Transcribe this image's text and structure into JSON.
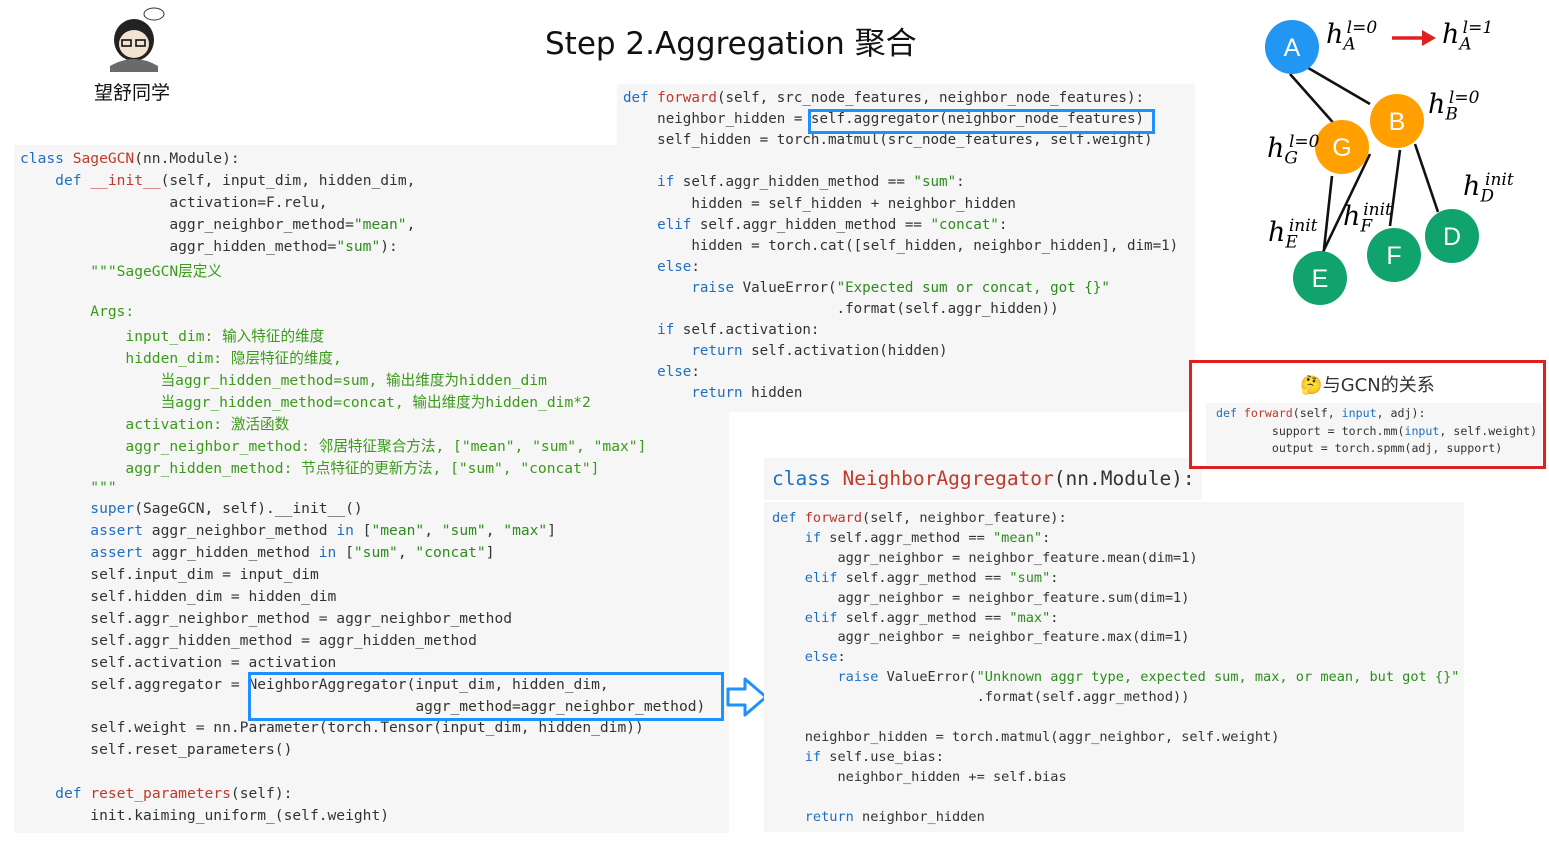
{
  "header": {
    "title": "Step 2.Aggregation  聚合",
    "brand": "望舒同学"
  },
  "sagegcn_code": [
    [
      [
        "kw",
        "class "
      ],
      [
        "fn",
        "SageGCN"
      ],
      [
        "",
        "(nn.Module):"
      ]
    ],
    [
      [
        "",
        "    "
      ],
      [
        "kw",
        "def "
      ],
      [
        "fn",
        "__init__"
      ],
      [
        "",
        "(self, input_dim, hidden_dim,"
      ]
    ],
    [
      [
        "",
        "                 activation=F.relu,"
      ]
    ],
    [
      [
        "",
        "                 aggr_neighbor_method="
      ],
      [
        "str",
        "\"mean\""
      ],
      [
        "",
        ","
      ]
    ],
    [
      [
        "",
        "                 aggr_hidden_method="
      ],
      [
        "str",
        "\"sum\""
      ],
      [
        "",
        "):"
      ]
    ],
    [
      [
        "cm",
        "        \"\"\"SageGCN层定义"
      ]
    ],
    [
      [
        "",
        ""
      ]
    ],
    [
      [
        "cm",
        "        Args:"
      ]
    ],
    [
      [
        "cm",
        "            input_dim: 输入特征的维度"
      ]
    ],
    [
      [
        "cm",
        "            hidden_dim: 隐层特征的维度,"
      ]
    ],
    [
      [
        "cm",
        "                当aggr_hidden_method=sum, 输出维度为hidden_dim"
      ]
    ],
    [
      [
        "cm",
        "                当aggr_hidden_method=concat, 输出维度为hidden_dim*2"
      ]
    ],
    [
      [
        "cm",
        "            activation: 激活函数"
      ]
    ],
    [
      [
        "cm",
        "            aggr_neighbor_method: 邻居特征聚合方法, [\"mean\", \"sum\", \"max\"]"
      ]
    ],
    [
      [
        "cm",
        "            aggr_hidden_method: 节点特征的更新方法, [\"sum\", \"concat\"]"
      ]
    ],
    [
      [
        "cm",
        "        \"\"\""
      ]
    ],
    [
      [
        "kw",
        "        super"
      ],
      [
        "",
        "(SageGCN, self).__init__()"
      ]
    ],
    [
      [
        "kw",
        "        assert "
      ],
      [
        "",
        "aggr_neighbor_method "
      ],
      [
        "kw",
        "in "
      ],
      [
        "",
        "["
      ],
      [
        "str",
        "\"mean\""
      ],
      [
        "",
        ", "
      ],
      [
        "str",
        "\"sum\""
      ],
      [
        "",
        ", "
      ],
      [
        "str",
        "\"max\""
      ],
      [
        "",
        "]"
      ]
    ],
    [
      [
        "kw",
        "        assert "
      ],
      [
        "",
        "aggr_hidden_method "
      ],
      [
        "kw",
        "in "
      ],
      [
        "",
        "["
      ],
      [
        "str",
        "\"sum\""
      ],
      [
        "",
        ", "
      ],
      [
        "str",
        "\"concat\""
      ],
      [
        "",
        "]"
      ]
    ],
    [
      [
        "",
        "        self.input_dim = input_dim"
      ]
    ],
    [
      [
        "",
        "        self.hidden_dim = hidden_dim"
      ]
    ],
    [
      [
        "",
        "        self.aggr_neighbor_method = aggr_neighbor_method"
      ]
    ],
    [
      [
        "",
        "        self.aggr_hidden_method = aggr_hidden_method"
      ]
    ],
    [
      [
        "",
        "        self.activation = activation"
      ]
    ],
    [
      [
        "",
        "        self.aggregator = NeighborAggregator(input_dim, hidden_dim,"
      ]
    ],
    [
      [
        "",
        "                                             aggr_method=aggr_neighbor_method)"
      ]
    ],
    [
      [
        "",
        "        self.weight = nn.Parameter(torch.Tensor(input_dim, hidden_dim))"
      ]
    ],
    [
      [
        "",
        "        self.reset_parameters()"
      ]
    ],
    [
      [
        "",
        ""
      ]
    ],
    [
      [
        "",
        "    "
      ],
      [
        "kw",
        "def "
      ],
      [
        "fn",
        "reset_parameters"
      ],
      [
        "",
        "(self):"
      ]
    ],
    [
      [
        "",
        "        init.kaiming_uniform_(self.weight)"
      ]
    ]
  ],
  "forward_code": [
    [
      [
        "kw",
        "def "
      ],
      [
        "fn",
        "forward"
      ],
      [
        "",
        "(self, src_node_features, neighbor_node_features):"
      ]
    ],
    [
      [
        "",
        "    neighbor_hidden = self.aggregator(neighbor_node_features)"
      ]
    ],
    [
      [
        "",
        "    self_hidden = torch.matmul(src_node_features, self.weight)"
      ]
    ],
    [
      [
        "",
        ""
      ]
    ],
    [
      [
        "kw",
        "    if "
      ],
      [
        "",
        "self.aggr_hidden_method == "
      ],
      [
        "str",
        "\"sum\""
      ],
      [
        "",
        ":"
      ]
    ],
    [
      [
        "",
        "        hidden = self_hidden + neighbor_hidden"
      ]
    ],
    [
      [
        "kw",
        "    elif "
      ],
      [
        "",
        "self.aggr_hidden_method == "
      ],
      [
        "str",
        "\"concat\""
      ],
      [
        "",
        ":"
      ]
    ],
    [
      [
        "",
        "        hidden = torch.cat([self_hidden, neighbor_hidden], dim=1)"
      ]
    ],
    [
      [
        "kw",
        "    else"
      ],
      [
        "",
        ":"
      ]
    ],
    [
      [
        "kw",
        "        raise "
      ],
      [
        "",
        "ValueError("
      ],
      [
        "str",
        "\"Expected sum or concat, got {}\""
      ]
    ],
    [
      [
        "",
        "                         .format(self.aggr_hidden)"
      ],
      [
        "",
        ")"
      ]
    ],
    [
      [
        "kw",
        "    if "
      ],
      [
        "",
        "self.activation:"
      ]
    ],
    [
      [
        "kw",
        "        return "
      ],
      [
        "",
        "self.activation(hidden)"
      ]
    ],
    [
      [
        "kw",
        "    else"
      ],
      [
        "",
        ":"
      ]
    ],
    [
      [
        "kw",
        "        return "
      ],
      [
        "",
        "hidden"
      ]
    ]
  ],
  "aggregator_header": [
    [
      "kw",
      "class "
    ],
    [
      "fn",
      "NeighborAggregator"
    ],
    [
      "",
      "(nn.Module):"
    ]
  ],
  "aggregator_code": [
    [
      [
        "kw",
        "def "
      ],
      [
        "fn",
        "forward"
      ],
      [
        "",
        "(self, neighbor_feature):"
      ]
    ],
    [
      [
        "kw",
        "    if "
      ],
      [
        "",
        "self.aggr_method == "
      ],
      [
        "str",
        "\"mean\""
      ],
      [
        "",
        ":"
      ]
    ],
    [
      [
        "",
        "        aggr_neighbor = neighbor_feature.mean(dim=1)"
      ]
    ],
    [
      [
        "kw",
        "    elif "
      ],
      [
        "",
        "self.aggr_method == "
      ],
      [
        "str",
        "\"sum\""
      ],
      [
        "",
        ":"
      ]
    ],
    [
      [
        "",
        "        aggr_neighbor = neighbor_feature.sum(dim=1)"
      ]
    ],
    [
      [
        "kw",
        "    elif "
      ],
      [
        "",
        "self.aggr_method == "
      ],
      [
        "str",
        "\"max\""
      ],
      [
        "",
        ":"
      ]
    ],
    [
      [
        "",
        "        aggr_neighbor = neighbor_feature.max(dim=1)"
      ]
    ],
    [
      [
        "kw",
        "    else"
      ],
      [
        "",
        ":"
      ]
    ],
    [
      [
        "kw",
        "        raise "
      ],
      [
        "",
        "ValueError("
      ],
      [
        "str",
        "\"Unknown aggr type, expected sum, max, or mean, but got {}\""
      ]
    ],
    [
      [
        "",
        "                         .format(self.aggr_method))"
      ]
    ],
    [
      [
        "",
        ""
      ]
    ],
    [
      [
        "",
        "    neighbor_hidden = torch.matmul(aggr_neighbor, self.weight)"
      ]
    ],
    [
      [
        "kw",
        "    if "
      ],
      [
        "",
        "self.use_bias:"
      ]
    ],
    [
      [
        "",
        "        neighbor_hidden += self.bias"
      ]
    ],
    [
      [
        "",
        ""
      ]
    ],
    [
      [
        "kw",
        "    return "
      ],
      [
        "",
        "neighbor_hidden"
      ]
    ]
  ],
  "gcn_relation": {
    "title": "🤔与GCN的关系",
    "code": [
      [
        [
          "kw",
          "def "
        ],
        [
          "fn",
          "forward"
        ],
        [
          "",
          "(self, "
        ],
        [
          "kw",
          "input"
        ],
        [
          "",
          ", adj):"
        ]
      ],
      [
        [
          "",
          "        support = torch.mm("
        ],
        [
          "kw",
          "input"
        ],
        [
          "",
          ", self.weight)"
        ]
      ],
      [
        [
          "",
          "        output = torch.spmm(adj, support)"
        ]
      ]
    ]
  },
  "graph": {
    "nodes": [
      {
        "id": "A",
        "color": "#2196f3"
      },
      {
        "id": "B",
        "color": "#ff9f00"
      },
      {
        "id": "G",
        "color": "#ff9f00"
      },
      {
        "id": "D",
        "color": "#10a36e"
      },
      {
        "id": "F",
        "color": "#10a36e"
      },
      {
        "id": "E",
        "color": "#10a36e"
      }
    ],
    "labels": {
      "hA0": {
        "h": "h",
        "sub": "A",
        "sup": "l=0"
      },
      "hA1": {
        "h": "h",
        "sub": "A",
        "sup": "l=1"
      },
      "hB0": {
        "h": "h",
        "sub": "B",
        "sup": "l=0"
      },
      "hG0": {
        "h": "h",
        "sub": "G",
        "sup": "l=0"
      },
      "hD": {
        "h": "h",
        "sub": "D",
        "sup": "init"
      },
      "hF": {
        "h": "h",
        "sub": "F",
        "sup": "init"
      },
      "hE": {
        "h": "h",
        "sub": "E",
        "sup": "init"
      }
    },
    "arrow_color": "#e02020"
  }
}
